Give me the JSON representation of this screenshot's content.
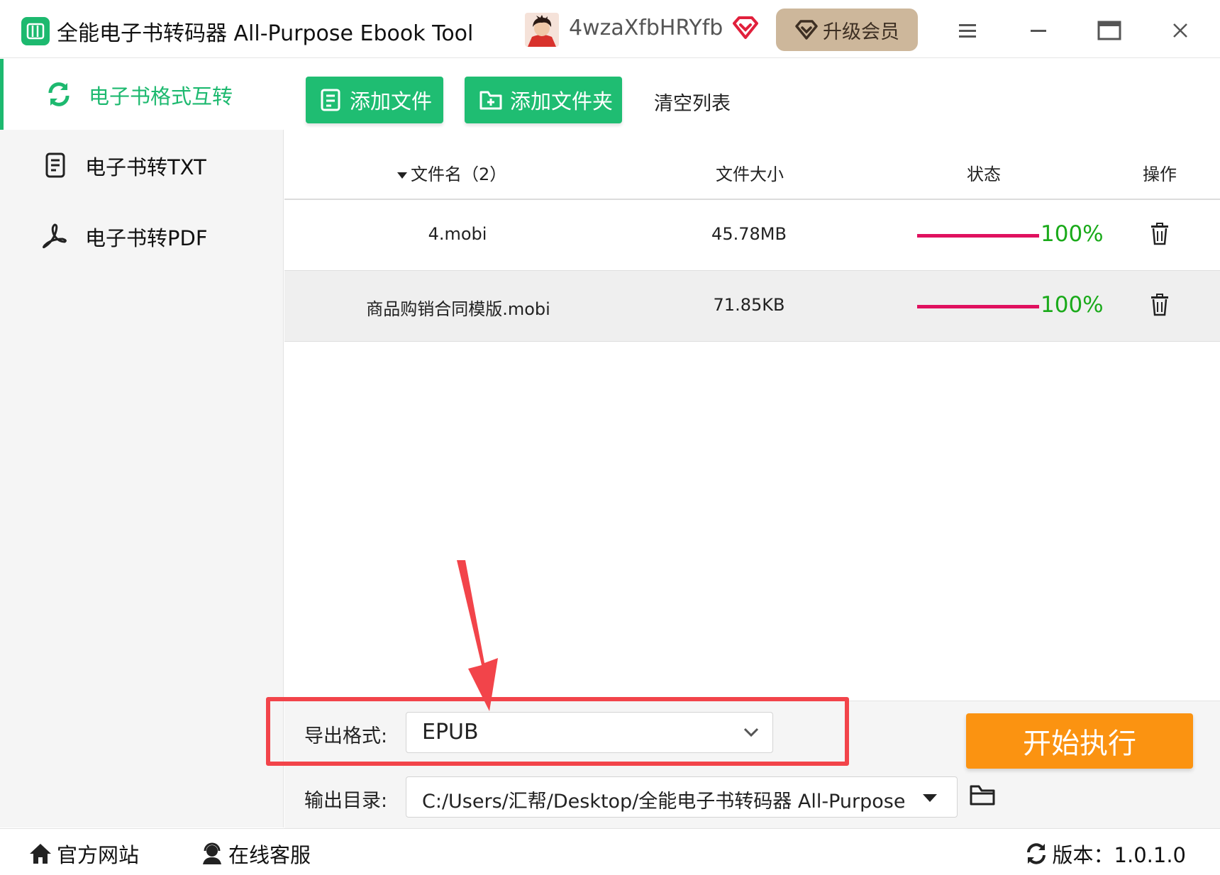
{
  "window": {
    "title": "全能电子书转码器 All-Purpose Ebook Tool",
    "username": "4wzaXfbHRYfb",
    "upgrade_label": "升级会员"
  },
  "sidebar": {
    "items": [
      {
        "label": "电子书格式互转",
        "icon": "refresh-icon",
        "active": true
      },
      {
        "label": "电子书转TXT",
        "icon": "document-icon",
        "active": false
      },
      {
        "label": "电子书转PDF",
        "icon": "pdf-icon",
        "active": false
      }
    ]
  },
  "toolbar": {
    "add_file": "添加文件",
    "add_folder": "添加文件夹",
    "clear_list": "清空列表"
  },
  "table": {
    "headers": {
      "filename": "文件名（2）",
      "size": "文件大小",
      "status": "状态",
      "action": "操作"
    },
    "rows": [
      {
        "filename": "4.mobi",
        "size": "45.78MB",
        "progress": 100,
        "progress_label": "100%"
      },
      {
        "filename": "商品购销合同模版.mobi",
        "size": "71.85KB",
        "progress": 100,
        "progress_label": "100%"
      }
    ]
  },
  "export": {
    "format_label": "导出格式:",
    "format_value": "EPUB",
    "dir_label": "输出目录:",
    "dir_value": "C:/Users/汇帮/Desktop/全能电子书转码器 All-Purpose Ebook Tool"
  },
  "start_button": "开始执行",
  "footer": {
    "website": "官方网站",
    "support": "在线客服",
    "version": "版本：1.0.1.0"
  },
  "colors": {
    "brand_green": "#1db96f",
    "start_orange": "#fb9311",
    "progress_bar": "#e0115f",
    "progress_text": "#1aaa1a",
    "annotation_red": "#f2444a",
    "upgrade_bg": "#cdb79b"
  }
}
